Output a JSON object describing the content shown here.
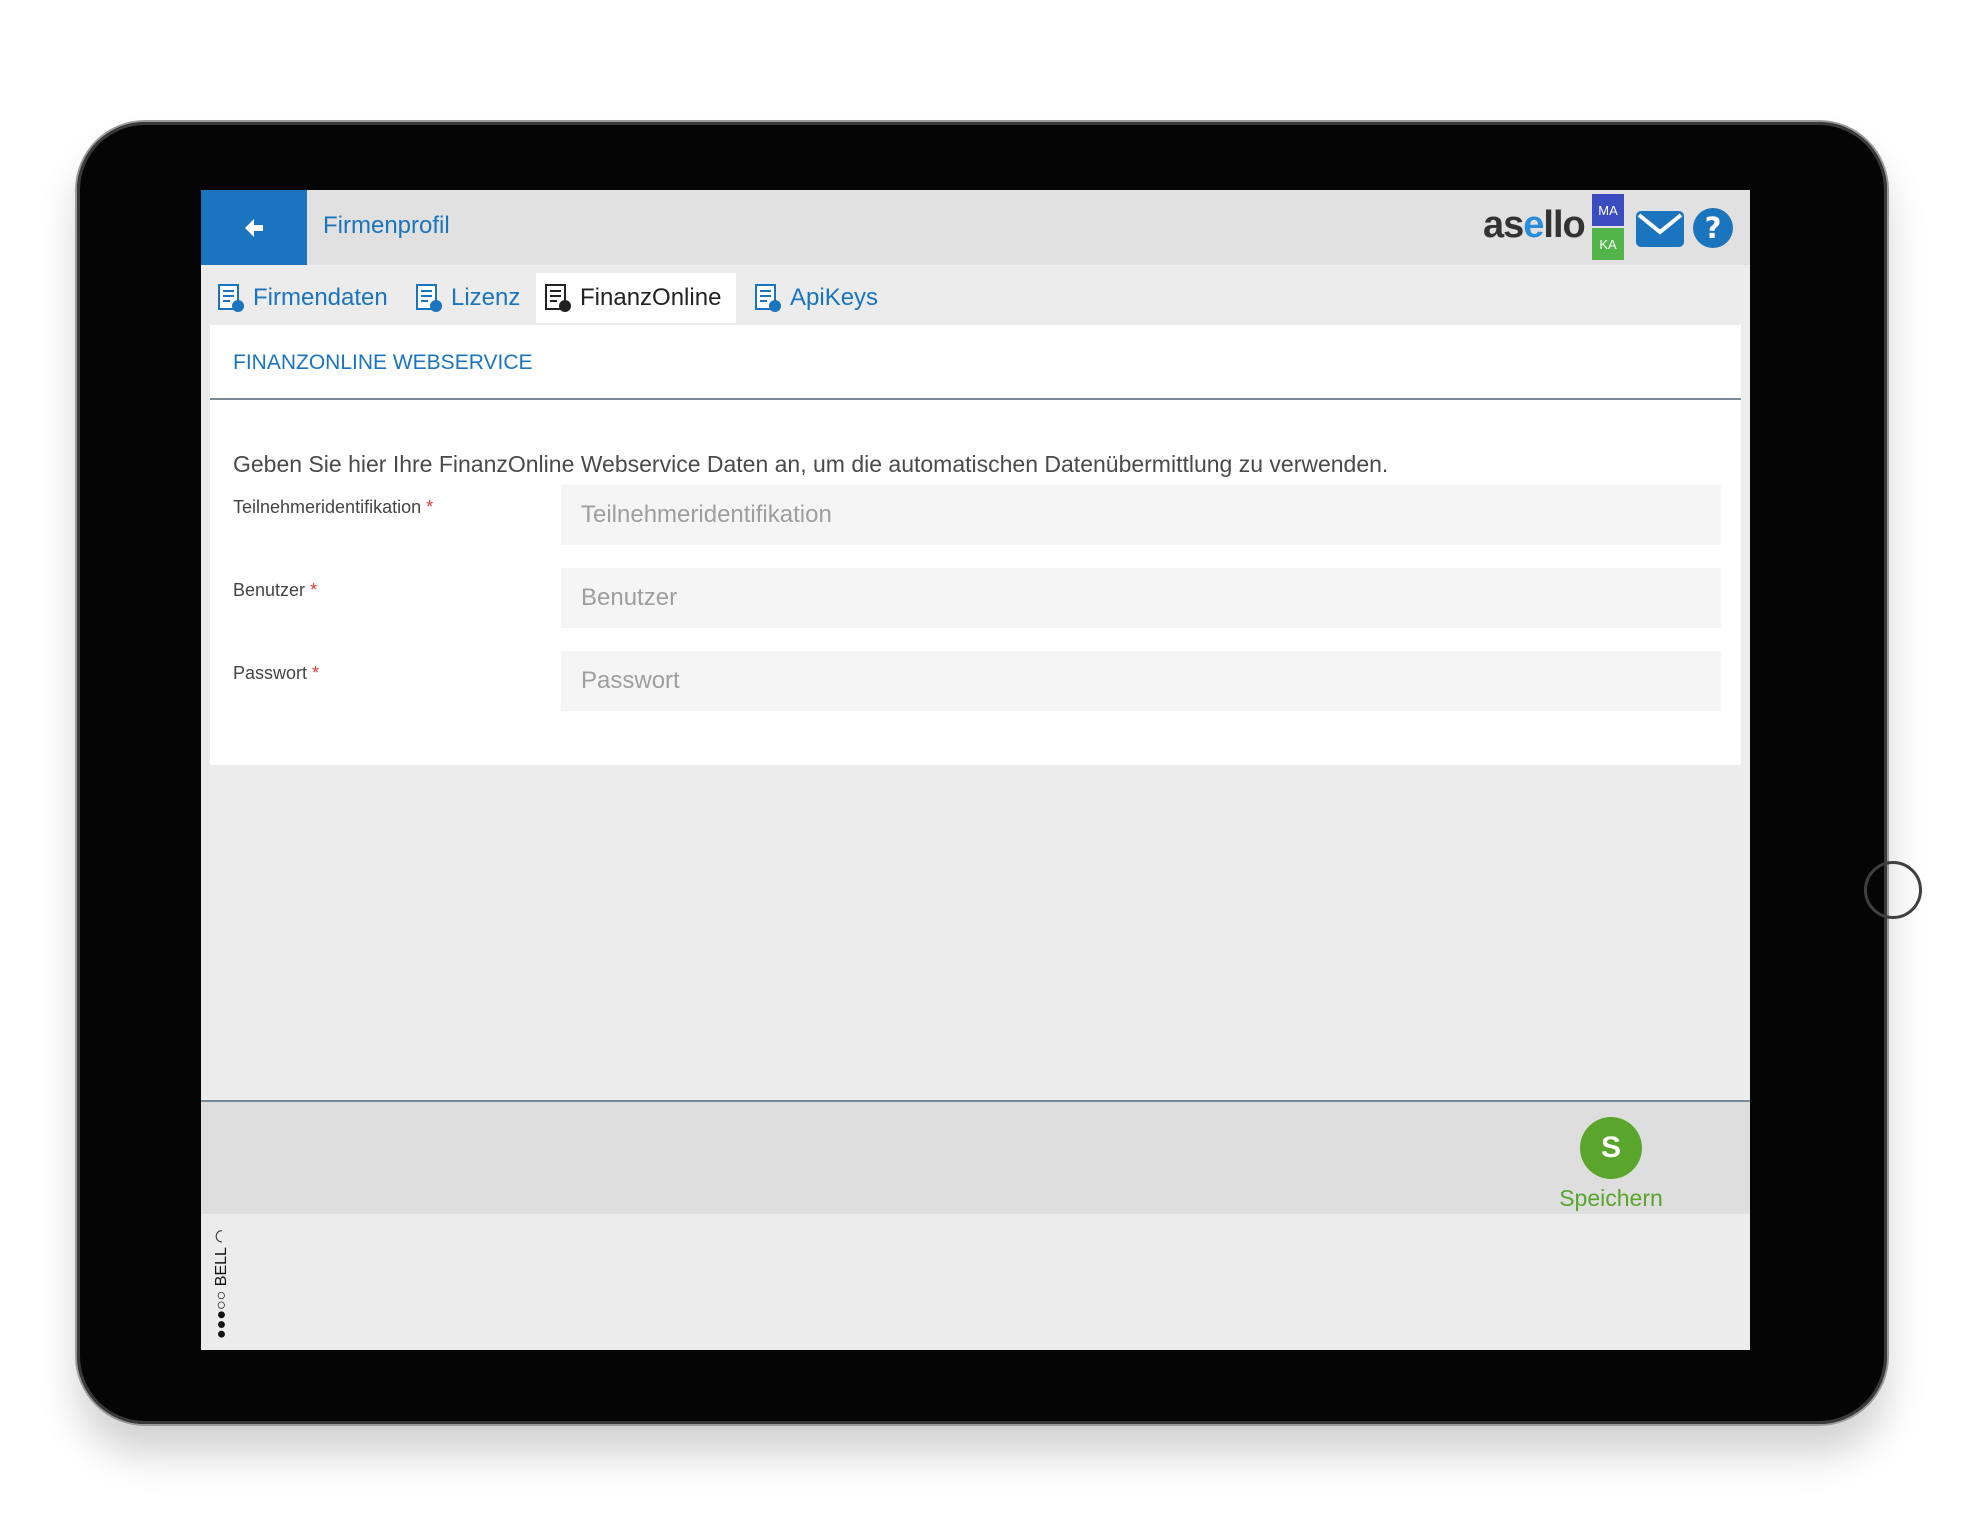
{
  "header": {
    "title": "Firmenprofil",
    "logo_prefix": "as",
    "logo_highlight": "e",
    "logo_suffix": "llo",
    "badge_top": "MA",
    "badge_bottom": "KA"
  },
  "tabs": [
    {
      "label": "Firmendaten",
      "active": false
    },
    {
      "label": "Lizenz",
      "active": false
    },
    {
      "label": "FinanzOnline",
      "active": true
    },
    {
      "label": "ApiKeys",
      "active": false
    }
  ],
  "section": {
    "title": "FINANZONLINE WEBSERVICE",
    "intro": "Geben Sie hier Ihre FinanzOnline Webservice Daten an, um die automatischen Datenübermittlung zu verwenden."
  },
  "form": {
    "required_marker": "*",
    "fields": [
      {
        "label": "Teilnehmeridentifikation",
        "placeholder": "Teilnehmeridentifikation",
        "value": ""
      },
      {
        "label": "Benutzer",
        "placeholder": "Benutzer",
        "value": ""
      },
      {
        "label": "Passwort",
        "placeholder": "Passwort",
        "value": ""
      }
    ]
  },
  "footer": {
    "save_icon_letter": "S",
    "save_label": "Speichern"
  },
  "statusbar": {
    "signal": "●●●○○",
    "carrier": "BELL"
  },
  "colors": {
    "primary": "#1a74be",
    "success": "#5aa52c",
    "required": "#e53935",
    "badge_ma": "#3b4cc0",
    "badge_ka": "#52b549"
  }
}
